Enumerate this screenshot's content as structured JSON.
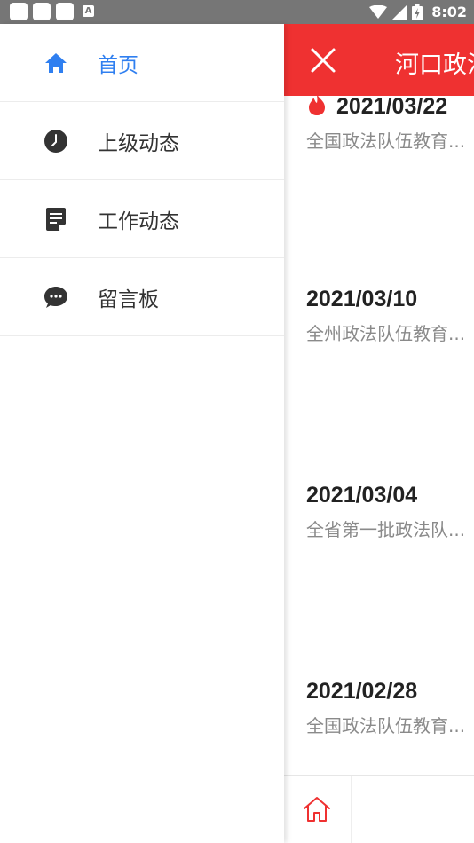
{
  "status_bar": {
    "time": "8:02",
    "notification_icons": [
      "app-icon",
      "app-icon",
      "app-icon",
      "a-icon"
    ],
    "system_icons": [
      "wifi-icon",
      "signal-icon",
      "battery-icon"
    ]
  },
  "drawer": {
    "items": [
      {
        "label": "首页",
        "icon": "home-icon",
        "active": true
      },
      {
        "label": "上级动态",
        "icon": "clock-icon",
        "active": false
      },
      {
        "label": "工作动态",
        "icon": "document-icon",
        "active": false
      },
      {
        "label": "留言板",
        "icon": "chat-icon",
        "active": false
      }
    ]
  },
  "main": {
    "title": "河口政法",
    "news": [
      {
        "date": "2021/03/22",
        "desc": "全国政法队伍教育...",
        "hot": true
      },
      {
        "date": "2021/03/10",
        "desc": "全州政法队伍教育...",
        "hot": false
      },
      {
        "date": "2021/03/04",
        "desc": "全省第一批政法队...",
        "hot": false
      },
      {
        "date": "2021/02/28",
        "desc": "全国政法队伍教育...",
        "hot": false
      }
    ]
  },
  "colors": {
    "accent_red": "#ef3131",
    "active_blue": "#2f7ff0",
    "status_bar": "#767676"
  }
}
